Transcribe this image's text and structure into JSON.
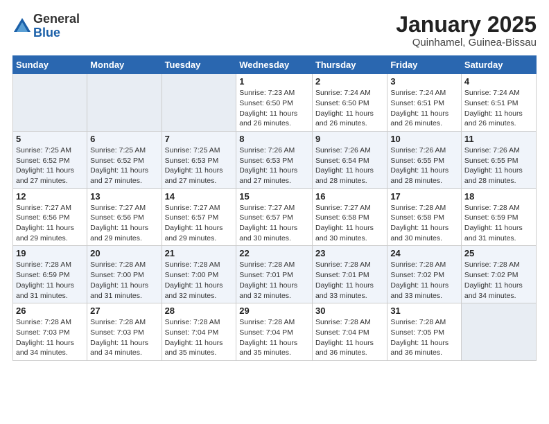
{
  "logo": {
    "general": "General",
    "blue": "Blue"
  },
  "title": "January 2025",
  "subtitle": "Quinhamel, Guinea-Bissau",
  "days_of_week": [
    "Sunday",
    "Monday",
    "Tuesday",
    "Wednesday",
    "Thursday",
    "Friday",
    "Saturday"
  ],
  "weeks": [
    [
      {
        "num": "",
        "info": ""
      },
      {
        "num": "",
        "info": ""
      },
      {
        "num": "",
        "info": ""
      },
      {
        "num": "1",
        "info": "Sunrise: 7:23 AM\nSunset: 6:50 PM\nDaylight: 11 hours and 26 minutes."
      },
      {
        "num": "2",
        "info": "Sunrise: 7:24 AM\nSunset: 6:50 PM\nDaylight: 11 hours and 26 minutes."
      },
      {
        "num": "3",
        "info": "Sunrise: 7:24 AM\nSunset: 6:51 PM\nDaylight: 11 hours and 26 minutes."
      },
      {
        "num": "4",
        "info": "Sunrise: 7:24 AM\nSunset: 6:51 PM\nDaylight: 11 hours and 26 minutes."
      }
    ],
    [
      {
        "num": "5",
        "info": "Sunrise: 7:25 AM\nSunset: 6:52 PM\nDaylight: 11 hours and 27 minutes."
      },
      {
        "num": "6",
        "info": "Sunrise: 7:25 AM\nSunset: 6:52 PM\nDaylight: 11 hours and 27 minutes."
      },
      {
        "num": "7",
        "info": "Sunrise: 7:25 AM\nSunset: 6:53 PM\nDaylight: 11 hours and 27 minutes."
      },
      {
        "num": "8",
        "info": "Sunrise: 7:26 AM\nSunset: 6:53 PM\nDaylight: 11 hours and 27 minutes."
      },
      {
        "num": "9",
        "info": "Sunrise: 7:26 AM\nSunset: 6:54 PM\nDaylight: 11 hours and 28 minutes."
      },
      {
        "num": "10",
        "info": "Sunrise: 7:26 AM\nSunset: 6:55 PM\nDaylight: 11 hours and 28 minutes."
      },
      {
        "num": "11",
        "info": "Sunrise: 7:26 AM\nSunset: 6:55 PM\nDaylight: 11 hours and 28 minutes."
      }
    ],
    [
      {
        "num": "12",
        "info": "Sunrise: 7:27 AM\nSunset: 6:56 PM\nDaylight: 11 hours and 29 minutes."
      },
      {
        "num": "13",
        "info": "Sunrise: 7:27 AM\nSunset: 6:56 PM\nDaylight: 11 hours and 29 minutes."
      },
      {
        "num": "14",
        "info": "Sunrise: 7:27 AM\nSunset: 6:57 PM\nDaylight: 11 hours and 29 minutes."
      },
      {
        "num": "15",
        "info": "Sunrise: 7:27 AM\nSunset: 6:57 PM\nDaylight: 11 hours and 30 minutes."
      },
      {
        "num": "16",
        "info": "Sunrise: 7:27 AM\nSunset: 6:58 PM\nDaylight: 11 hours and 30 minutes."
      },
      {
        "num": "17",
        "info": "Sunrise: 7:28 AM\nSunset: 6:58 PM\nDaylight: 11 hours and 30 minutes."
      },
      {
        "num": "18",
        "info": "Sunrise: 7:28 AM\nSunset: 6:59 PM\nDaylight: 11 hours and 31 minutes."
      }
    ],
    [
      {
        "num": "19",
        "info": "Sunrise: 7:28 AM\nSunset: 6:59 PM\nDaylight: 11 hours and 31 minutes."
      },
      {
        "num": "20",
        "info": "Sunrise: 7:28 AM\nSunset: 7:00 PM\nDaylight: 11 hours and 31 minutes."
      },
      {
        "num": "21",
        "info": "Sunrise: 7:28 AM\nSunset: 7:00 PM\nDaylight: 11 hours and 32 minutes."
      },
      {
        "num": "22",
        "info": "Sunrise: 7:28 AM\nSunset: 7:01 PM\nDaylight: 11 hours and 32 minutes."
      },
      {
        "num": "23",
        "info": "Sunrise: 7:28 AM\nSunset: 7:01 PM\nDaylight: 11 hours and 33 minutes."
      },
      {
        "num": "24",
        "info": "Sunrise: 7:28 AM\nSunset: 7:02 PM\nDaylight: 11 hours and 33 minutes."
      },
      {
        "num": "25",
        "info": "Sunrise: 7:28 AM\nSunset: 7:02 PM\nDaylight: 11 hours and 34 minutes."
      }
    ],
    [
      {
        "num": "26",
        "info": "Sunrise: 7:28 AM\nSunset: 7:03 PM\nDaylight: 11 hours and 34 minutes."
      },
      {
        "num": "27",
        "info": "Sunrise: 7:28 AM\nSunset: 7:03 PM\nDaylight: 11 hours and 34 minutes."
      },
      {
        "num": "28",
        "info": "Sunrise: 7:28 AM\nSunset: 7:04 PM\nDaylight: 11 hours and 35 minutes."
      },
      {
        "num": "29",
        "info": "Sunrise: 7:28 AM\nSunset: 7:04 PM\nDaylight: 11 hours and 35 minutes."
      },
      {
        "num": "30",
        "info": "Sunrise: 7:28 AM\nSunset: 7:04 PM\nDaylight: 11 hours and 36 minutes."
      },
      {
        "num": "31",
        "info": "Sunrise: 7:28 AM\nSunset: 7:05 PM\nDaylight: 11 hours and 36 minutes."
      },
      {
        "num": "",
        "info": ""
      }
    ]
  ]
}
